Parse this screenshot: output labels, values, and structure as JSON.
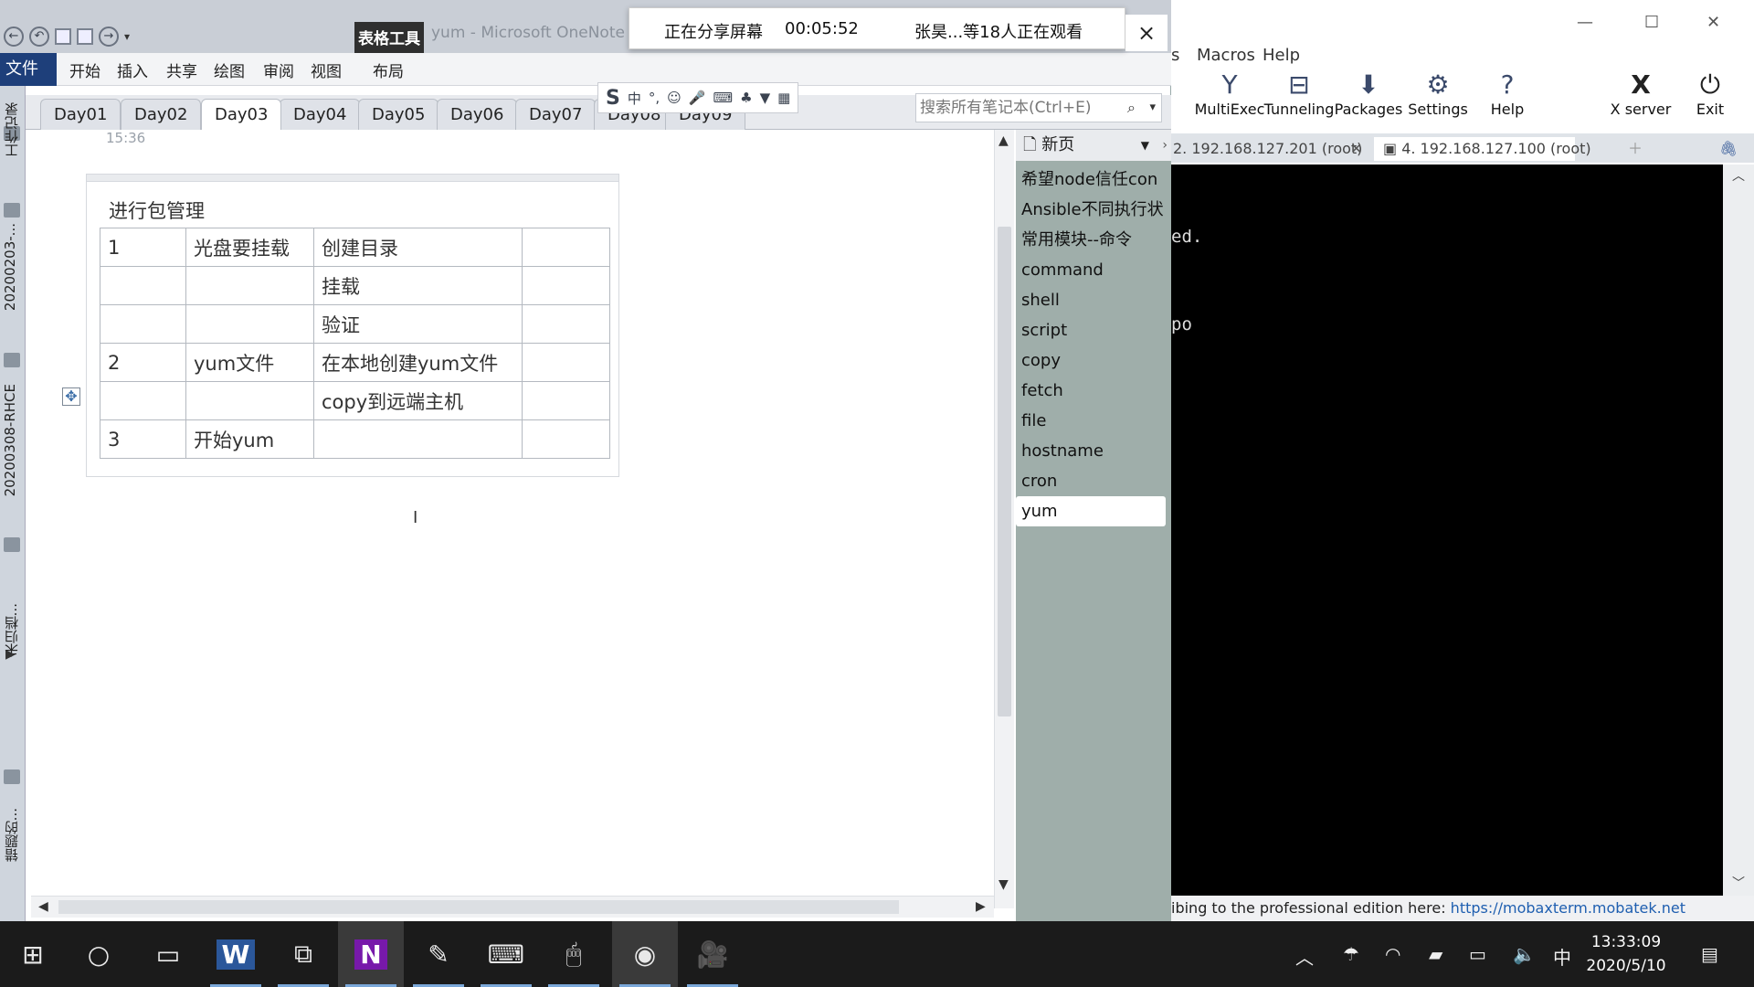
{
  "onenote": {
    "context_tab": "表格工具",
    "window_title": "yum - Microsoft OneNote",
    "ribbon_tabs": [
      "文件",
      "开始",
      "插入",
      "共享",
      "绘图",
      "审阅",
      "视图",
      "布局"
    ],
    "section_tabs": [
      "Day01",
      "Day02",
      "Day03",
      "Day04",
      "Day05",
      "Day06",
      "Day07",
      "Day08",
      "Day09"
    ],
    "active_section_index": 2,
    "search_placeholder": "搜索所有笔记本(Ctrl+E)",
    "notebook_bar_labels": [
      "工作记录",
      "20200203-...",
      "20200308-RHCE",
      "未归档...",
      "错题的..."
    ],
    "page_date": "15:36",
    "note_title": "进行包管理",
    "table": [
      [
        "1",
        "光盘要挂载",
        "创建目录",
        ""
      ],
      [
        "",
        "",
        "挂载",
        ""
      ],
      [
        "",
        "",
        "验证",
        ""
      ],
      [
        "2",
        "yum文件",
        "在本地创建yum文件",
        ""
      ],
      [
        "",
        "",
        "copy到远端主机",
        ""
      ],
      [
        "3",
        "开始yum",
        "",
        ""
      ]
    ],
    "page_list_header": "新页",
    "pages": [
      "希望node信任con",
      "Ansible不同执行状",
      "常用模块--命令",
      "command",
      "shell",
      "script",
      "copy",
      "fetch",
      "file",
      "hostname",
      "cron",
      "yum"
    ],
    "active_page_index": 11
  },
  "share_banner": {
    "status": "正在分享屏幕",
    "timer": "00:05:52",
    "viewers": "张昊...等18人正在观看"
  },
  "moba": {
    "menu": [
      "s",
      "Macros",
      "Help"
    ],
    "tools": [
      {
        "label": "MultiExec",
        "icon": "multiexec-icon"
      },
      {
        "label": "Tunneling",
        "icon": "tunneling-icon"
      },
      {
        "label": "Packages",
        "icon": "packages-icon"
      },
      {
        "label": "Settings",
        "icon": "settings-icon"
      },
      {
        "label": "Help",
        "icon": "help-icon"
      },
      {
        "label": "X server",
        "icon": "x-server-icon"
      },
      {
        "label": "Exit",
        "icon": "power-icon"
      }
    ],
    "sessions": [
      "2. 192.168.127.201 (root)",
      "4. 192.168.127.100 (root)"
    ],
    "terminal_lines": [
      "ed.",
      "po"
    ],
    "status_text": "ibing to the professional edition here:",
    "status_link": "https://mobaxterm.mobatek.net"
  },
  "taskbar": {
    "ime": "中",
    "time": "13:33:09",
    "date": "2020/5/10"
  },
  "colors": {
    "onenote_file_tab": "#1e3f7a",
    "page_list_bg": "#9faeaa",
    "taskbar_bg": "#1b1b1b",
    "terminal_bg": "#000000",
    "link": "#1f5fb0"
  }
}
